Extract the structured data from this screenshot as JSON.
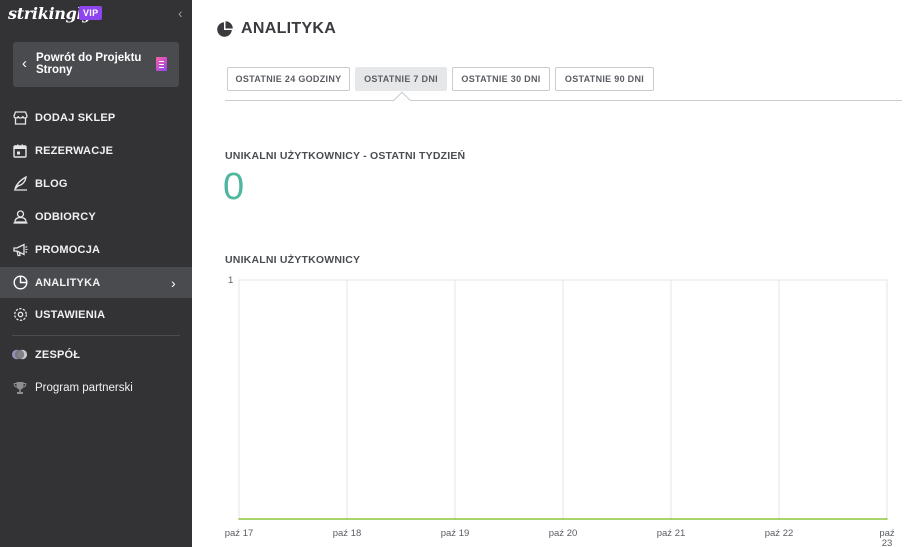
{
  "sidebar": {
    "logo": "strikingly",
    "vip_badge": "VIP",
    "collapse_icon": "chevron-left-icon",
    "back_button": {
      "label": "Powrót do Projektu Strony",
      "icon": "document-icon"
    },
    "items": [
      {
        "label": "DODAJ SKLEP",
        "icon": "store-icon"
      },
      {
        "label": "REZERWACJE",
        "icon": "calendar-icon"
      },
      {
        "label": "BLOG",
        "icon": "quill-icon"
      },
      {
        "label": "ODBIORCY",
        "icon": "contacts-icon"
      },
      {
        "label": "PROMOCJA",
        "icon": "megaphone-icon"
      },
      {
        "label": "ANALITYKA",
        "icon": "pie-chart-icon",
        "active": true
      },
      {
        "label": "USTAWIENIA",
        "icon": "gear-icon"
      },
      {
        "label": "ZESPÓŁ",
        "icon": "team-icon"
      },
      {
        "label": "Program partnerski",
        "icon": "trophy-icon"
      }
    ],
    "active_arrow": "›"
  },
  "main": {
    "title": "ANALITYKA",
    "title_icon": "pie-chart-icon",
    "tabs": [
      {
        "label": "OSTATNIE 24 GODZINY"
      },
      {
        "label": "OSTATNIE 7 DNI",
        "active": true
      },
      {
        "label": "OSTATNIE 30 DNI"
      },
      {
        "label": "OSTATNIE 90 DNI"
      }
    ],
    "unique_users_week_label": "UNIKALNI UŻYTKOWNICY - OSTATNI TYDZIEŃ",
    "unique_users_week_value": "0",
    "chart_label": "UNIKALNI UŻYTKOWNICY"
  },
  "colors": {
    "sidebar_bg": "#333336",
    "accent_teal": "#4fb79f",
    "line_green": "#8dc63f",
    "vip_purple": "#8e44ef"
  },
  "chart_data": {
    "type": "line",
    "categories": [
      "paź 17",
      "paź 18",
      "paź 19",
      "paź 20",
      "paź 21",
      "paź 22",
      "paź 23"
    ],
    "series": [
      {
        "values": [
          0,
          0,
          0,
          0,
          0,
          0,
          0
        ]
      }
    ],
    "yticks": [
      "1"
    ],
    "ylim": [
      0,
      1
    ],
    "grid": true,
    "title": "",
    "xlabel": "",
    "ylabel": ""
  }
}
